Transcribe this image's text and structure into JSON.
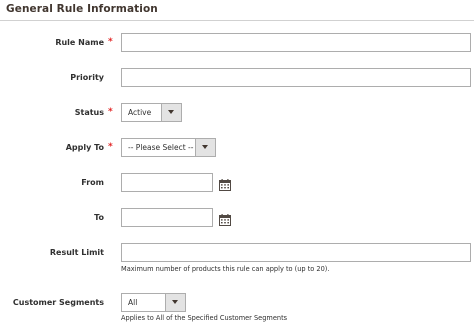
{
  "section": {
    "title": "General Rule Information"
  },
  "fields": {
    "rule_name": {
      "label": "Rule Name",
      "required": "*",
      "value": ""
    },
    "priority": {
      "label": "Priority",
      "value": ""
    },
    "status": {
      "label": "Status",
      "required": "*",
      "selected": "Active"
    },
    "apply_to": {
      "label": "Apply To",
      "required": "*",
      "selected": "-- Please Select --"
    },
    "from": {
      "label": "From",
      "value": ""
    },
    "to": {
      "label": "To",
      "value": ""
    },
    "result_limit": {
      "label": "Result Limit",
      "value": "",
      "note": "Maximum number of products this rule can apply to (up to 20)."
    },
    "customer_segments": {
      "label": "Customer Segments",
      "selected": "All",
      "note": "Applies to All of the Specified Customer Segments"
    }
  },
  "icons": {
    "calendar": "calendar-icon",
    "dropdown": "chevron-down-icon"
  }
}
